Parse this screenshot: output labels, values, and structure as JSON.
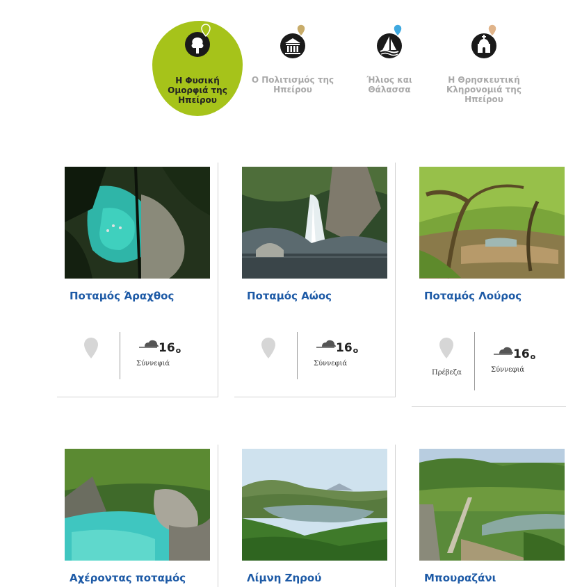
{
  "categories": [
    {
      "label": "Η Φυσική Ομορφιά της Ηπείρου",
      "active": true,
      "icon": "tree-icon"
    },
    {
      "label": "Ο Πολιτισμός της Ηπείρου",
      "active": false,
      "icon": "temple-icon"
    },
    {
      "label": "Ήλιος και Θάλασσα",
      "active": false,
      "icon": "sailboat-icon"
    },
    {
      "label": "Η Θρησκευτική Κληρονομιά της Ηπείρου",
      "active": false,
      "icon": "church-icon"
    }
  ],
  "colors": {
    "accent": "#a6c31a",
    "link": "#1d5aa6",
    "muted_label": "#a9a9a9",
    "pin_marker": "#f2b544"
  },
  "cards": [
    {
      "title": "Ποταμός Άραχθος",
      "temp": "16",
      "degree_symbol": "o",
      "condition": "Σύννεφιά",
      "place": ""
    },
    {
      "title": "Ποταμός Αώος",
      "temp": "16",
      "degree_symbol": "o",
      "condition": "Σύννεφιά",
      "place": ""
    },
    {
      "title": "Ποταμός Λούρος",
      "temp": "16",
      "degree_symbol": "o",
      "condition": "Σύννεφιά",
      "place": "Πρέβεζα"
    },
    {
      "title": "Αχέροντας ποταμός"
    },
    {
      "title": "Λίμνη Ζηρού"
    },
    {
      "title": "Μπουραζάνι"
    }
  ]
}
